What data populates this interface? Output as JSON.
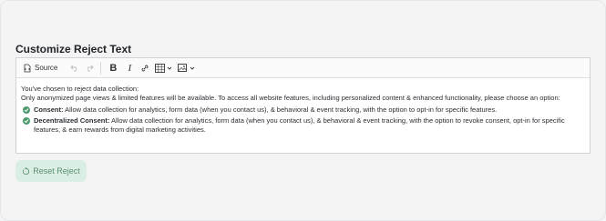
{
  "section": {
    "title": "Customize Reject Text"
  },
  "toolbar": {
    "source_label": "Source",
    "undo": "undo-icon",
    "redo": "redo-icon",
    "bold": "B",
    "italic": "I",
    "link": "link-icon",
    "table": "table-icon",
    "image": "image-icon"
  },
  "editor": {
    "line1": "You've chosen to reject data collection:",
    "line2": "Only anonymized page views & limited features will be available. To access all website features, including personalized content & enhanced functionality, please choose an option:",
    "bullets": [
      {
        "label": "Consent:",
        "text": " Allow data collection for analytics, form data (when you contact us), & behavioral & event tracking, with the option to opt-in for specific features."
      },
      {
        "label": "Decentralized Consent:",
        "text": " Allow data collection for analytics, form data (when you contact us), & behavioral & event tracking, with the option to revoke consent, opt-in for specific features, & earn rewards from digital marketing activities."
      }
    ]
  },
  "reset_button": {
    "label": "Reset Reject"
  },
  "colors": {
    "accent": "#4c9a6e",
    "reset_bg": "#dbeee3",
    "reset_text": "#5a8f73"
  }
}
